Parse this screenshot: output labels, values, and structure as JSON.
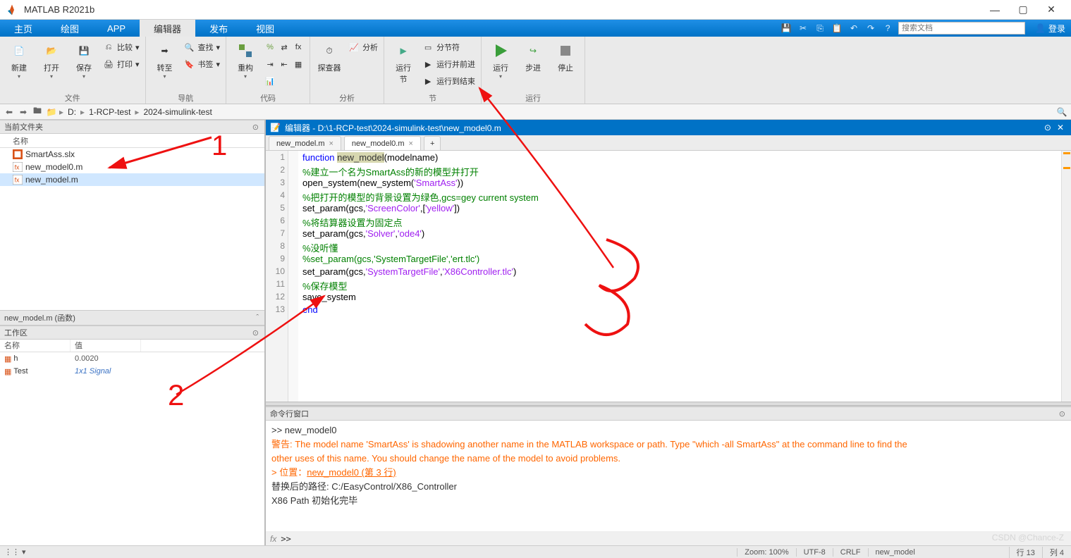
{
  "app": {
    "title": "MATLAB R2021b"
  },
  "window_buttons": {
    "min": "—",
    "max": "▢",
    "close": "✕"
  },
  "tabs": {
    "t1": "主页",
    "t2": "绘图",
    "t3": "APP",
    "t4": "编辑器",
    "t5": "发布",
    "t6": "视图"
  },
  "search_placeholder": "搜索文档",
  "login": "登录",
  "ribbon": {
    "file": {
      "new": "新建",
      "open": "打开",
      "save": "保存",
      "compare": "比较",
      "print": "打印",
      "group": "文件"
    },
    "nav": {
      "goto": "转至",
      "find": "查找",
      "bookmark": "书签",
      "group": "导航"
    },
    "code": {
      "refactor": "重构",
      "analyze": "分析",
      "group": "代码"
    },
    "section": {
      "profiler": "探查器",
      "runsec": "运行\n节",
      "split": "分节符",
      "runadv": "运行并前进",
      "runend": "运行到结束",
      "group": "分析",
      "group2": "节"
    },
    "run": {
      "run": "运行",
      "step": "步进",
      "stop": "停止",
      "group": "运行"
    }
  },
  "path": {
    "drive": "D:",
    "p1": "1-RCP-test",
    "p2": "2024-simulink-test"
  },
  "left": {
    "current_folder": "当前文件夹",
    "name_col": "名称",
    "files": [
      {
        "name": "SmartAss.slx",
        "type": "slx"
      },
      {
        "name": "new_model0.m",
        "type": "m"
      },
      {
        "name": "new_model.m",
        "type": "m",
        "sel": true
      }
    ],
    "details": "new_model.m (函数)",
    "workspace": "工作区",
    "ws_name": "名称",
    "ws_val": "值",
    "ws_rows": [
      {
        "name": "h",
        "val": "0.0020",
        "italic": false
      },
      {
        "name": "Test",
        "val": "1x1 Signal",
        "italic": true
      }
    ]
  },
  "editor": {
    "title": "编辑器 - D:\\1-RCP-test\\2024-simulink-test\\new_model0.m",
    "tabs": [
      {
        "label": "new_model.m",
        "active": false
      },
      {
        "label": "new_model0.m",
        "active": true
      }
    ],
    "code": [
      {
        "n": 1,
        "seg": [
          [
            "kw",
            "function "
          ],
          [
            "hl",
            "new_model"
          ],
          [
            "fn",
            "("
          ],
          [
            "fn",
            "modelname"
          ],
          [
            "fn",
            ")"
          ]
        ]
      },
      {
        "n": 2,
        "seg": [
          [
            "com",
            "%建立一个名为SmartAss的新的模型并打开"
          ]
        ]
      },
      {
        "n": 3,
        "seg": [
          [
            "fn",
            "open_system(new_system("
          ],
          [
            "str",
            "'SmartAss'"
          ],
          [
            "fn",
            "))"
          ]
        ]
      },
      {
        "n": 4,
        "seg": [
          [
            "com",
            "%把打开的模型的背景设置为绿色,gcs=gey current system"
          ]
        ]
      },
      {
        "n": 5,
        "seg": [
          [
            "fn",
            "set_param(gcs,"
          ],
          [
            "str",
            "'ScreenColor'"
          ],
          [
            "fn",
            ",["
          ],
          [
            "str",
            "'yellow'"
          ],
          [
            "fn",
            "])"
          ]
        ]
      },
      {
        "n": 6,
        "seg": [
          [
            "com",
            "%将结算器设置为固定点"
          ]
        ]
      },
      {
        "n": 7,
        "seg": [
          [
            "fn",
            "set_param(gcs,"
          ],
          [
            "str",
            "'Solver'"
          ],
          [
            "fn",
            ","
          ],
          [
            "str",
            "'ode4'"
          ],
          [
            "fn",
            ")"
          ]
        ]
      },
      {
        "n": 8,
        "seg": [
          [
            "com",
            "%没听懂"
          ]
        ]
      },
      {
        "n": 9,
        "seg": [
          [
            "com",
            "%set_param(gcs,'SystemTargetFile','ert.tlc')"
          ]
        ]
      },
      {
        "n": 10,
        "seg": [
          [
            "fn",
            "set_param(gcs,"
          ],
          [
            "str",
            "'SystemTargetFile'"
          ],
          [
            "fn",
            ","
          ],
          [
            "str",
            "'X86Controller.tlc'"
          ],
          [
            "fn",
            ")"
          ]
        ]
      },
      {
        "n": 11,
        "seg": [
          [
            "com",
            "%保存模型"
          ]
        ]
      },
      {
        "n": 12,
        "seg": [
          [
            "fn",
            "save_system"
          ]
        ]
      },
      {
        "n": 13,
        "seg": [
          [
            "kw",
            "end"
          ]
        ]
      }
    ]
  },
  "cmd": {
    "title": "命令行窗口",
    "lines": [
      {
        "cls": "",
        "txt": ">> new_model0"
      },
      {
        "cls": "warn",
        "txt": "警告: The model name 'SmartAss' is shadowing another name in the MATLAB workspace or path. Type \"which -all SmartAss\" at the command line to find the\nother uses of this name. You should change the name of the model to avoid problems."
      },
      {
        "cls": "warn",
        "txt": "> 位置：",
        "link": "new_model0 (第 3 行)"
      },
      {
        "cls": "",
        "txt": "替换后的路径: C:/EasyControl/X86_Controller"
      },
      {
        "cls": "",
        "txt": "X86 Path 初始化完毕"
      }
    ],
    "prompt": ">> "
  },
  "status": {
    "zoom": "Zoom: 100%",
    "enc": "UTF-8",
    "eol": "CRLF",
    "fn": "new_model",
    "ln": "行 13",
    "col": "列 4"
  },
  "watermark": "CSDN @Chance-Z"
}
